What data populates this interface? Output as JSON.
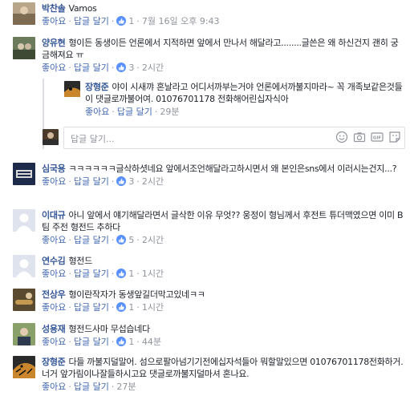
{
  "actions": {
    "like": "좋아요",
    "reply": "답글 달기",
    "sep": "·"
  },
  "reply_box": {
    "placeholder": "답글 달기..."
  },
  "comments": [
    {
      "author": "박찬솔",
      "text": "Vamos",
      "likes": "1",
      "time": "7월 16일 오후 9:43"
    },
    {
      "author": "양유현",
      "text": "형이든 동생이든 언론에서 지적하면 앞에서 만나서 해달라고........글쓴은 왜 하신건지 괜히 궁금해져요 ㅠ",
      "likes": "3",
      "time": "2시간"
    },
    {
      "author": "장형준",
      "text": "야이 시새꺄 혼날라고 어디서까부는거야 언론에서까불지마라~ 꼭 개족보같은것들이 댓글로까불어여. 01076701178 전화해어린십자식아",
      "time": "29분"
    },
    {
      "author": "심국용",
      "text": "ㅋㅋㅋㅋㅋㅋ글삭하셧네요 앞에서조언해달라고하시면서 왜 본인은sns에서 이러시는건지...?",
      "likes": "3",
      "time": "2시간"
    },
    {
      "author": "이대규",
      "text": "아니 앞에서 얘기해달라면서 글삭한 이유 무엇?? 웅정이 형님께서 후전트 튜더맥였으면 이미 B팀 주전 형전드 추하다",
      "likes": "5",
      "time": "2시간"
    },
    {
      "author": "연수김",
      "text": "형전드",
      "likes": "1",
      "time": "1시간"
    },
    {
      "author": "전상우",
      "text": "형이란작자가 동생앞길더막고있네ㅋㅋ",
      "likes": "1",
      "time": "1시간"
    },
    {
      "author": "성용재",
      "text": "형전드사마 무섭습네다",
      "likes": "1",
      "time": "44분"
    },
    {
      "author": "장형준",
      "text": "다들 까불지덜말어. 섬으로팔아넘기기전에십자석들아 뭐할말있으면 01076701178전화하거. 너거 앞가림이나잘들하시고요 댓글로까불지덜마셔 혼나요.",
      "time": "27분"
    }
  ],
  "colors": {
    "link": "#365899",
    "action": "#4267b2",
    "meta": "#90949c",
    "like": "#5890ff"
  }
}
